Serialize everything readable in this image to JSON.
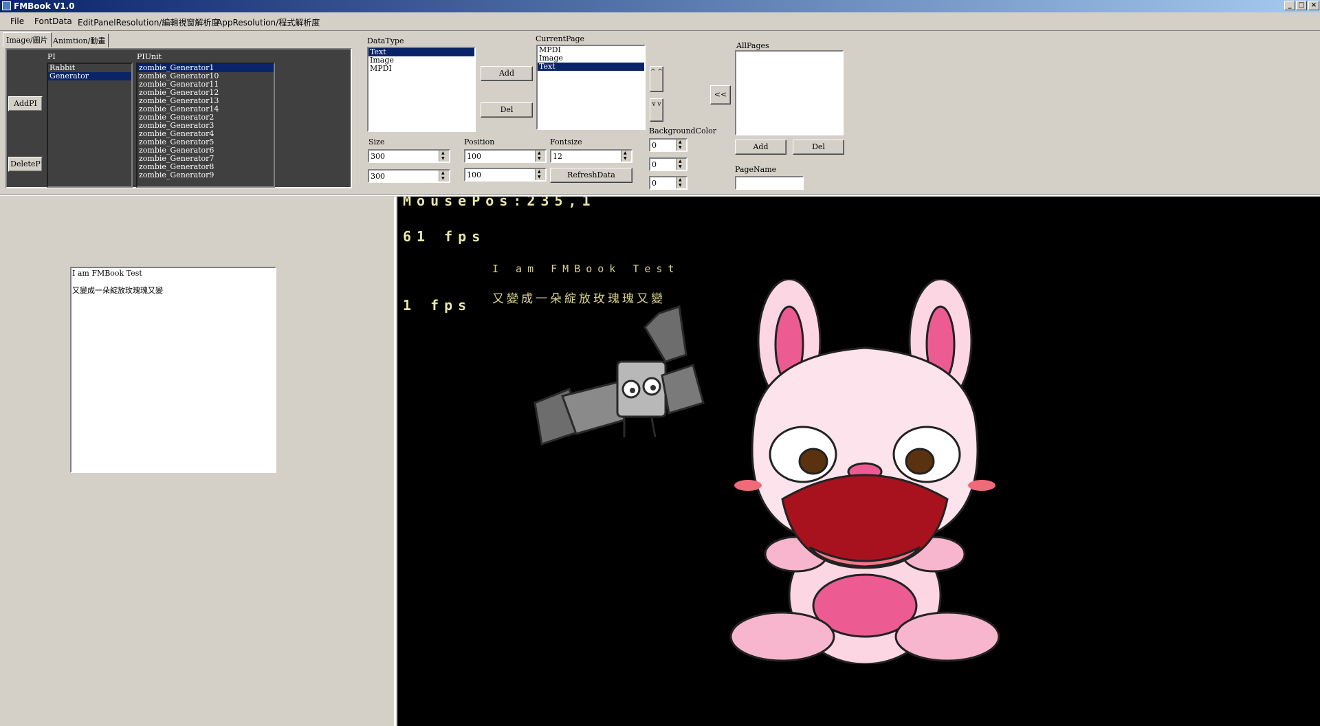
{
  "window": {
    "title": "FMBook V1.0",
    "min": "_",
    "max": "□",
    "close": "×"
  },
  "menu": [
    "File",
    "FontData",
    "EditPanelResolution/編輯視窗解析度",
    "AppResolution/程式解析度"
  ],
  "tabs": [
    {
      "label": "Image/圖片"
    },
    {
      "label": "Animtion/動畫"
    }
  ],
  "pi_panel": {
    "addpi_label": "AddPI",
    "deletep_label": "DeleteP",
    "pi_label": "PI",
    "piunit_label": "PIUnit",
    "pi_items": [
      "Rabbit",
      "Generator"
    ],
    "pi_selected": 1,
    "piunit_items": [
      "zombie_Generator1",
      "zombie_Generator10",
      "zombie_Generator11",
      "zombie_Generator12",
      "zombie_Generator13",
      "zombie_Generator14",
      "zombie_Generator2",
      "zombie_Generator3",
      "zombie_Generator4",
      "zombie_Generator5",
      "zombie_Generator6",
      "zombie_Generator7",
      "zombie_Generator8",
      "zombie_Generator9"
    ],
    "piunit_selected": 0
  },
  "datatype": {
    "label": "DataType",
    "items": [
      "Text",
      "Image",
      "MPDI"
    ],
    "selected": 0,
    "add_label": "Add",
    "del_label": "Del"
  },
  "currentpage": {
    "label": "CurrentPage",
    "items": [
      "MPDI",
      "Image",
      "Text"
    ],
    "selected": 2,
    "up_label": "^ ^",
    "down_label": "v v"
  },
  "allpages": {
    "label": "AllPages",
    "move_label": "<<",
    "add_label": "Add",
    "del_label": "Del",
    "pagename_label": "PageName",
    "pagename_value": ""
  },
  "props": {
    "size_label": "Size",
    "size_w": "300",
    "size_h": "300",
    "position_label": "Position",
    "pos_x": "100",
    "pos_y": "100",
    "fontsize_label": "Fontsize",
    "fontsize": "12",
    "refresh_label": "RefreshData",
    "bgcolor_label": "BackgroundColor",
    "bg_r": "0",
    "bg_g": "0",
    "bg_b": "0"
  },
  "text_editor": {
    "line1": "I am FMBook Test",
    "line2": "又變成一朵綻放玫瑰瑰又變"
  },
  "canvas": {
    "mousepos": "MousePos:235,1",
    "fps1": "61 fps",
    "fps2": "1 fps",
    "sample_line1": "I am FMBook Test",
    "sample_line2": "又變成一朵綻放玫瑰瑰又變"
  }
}
